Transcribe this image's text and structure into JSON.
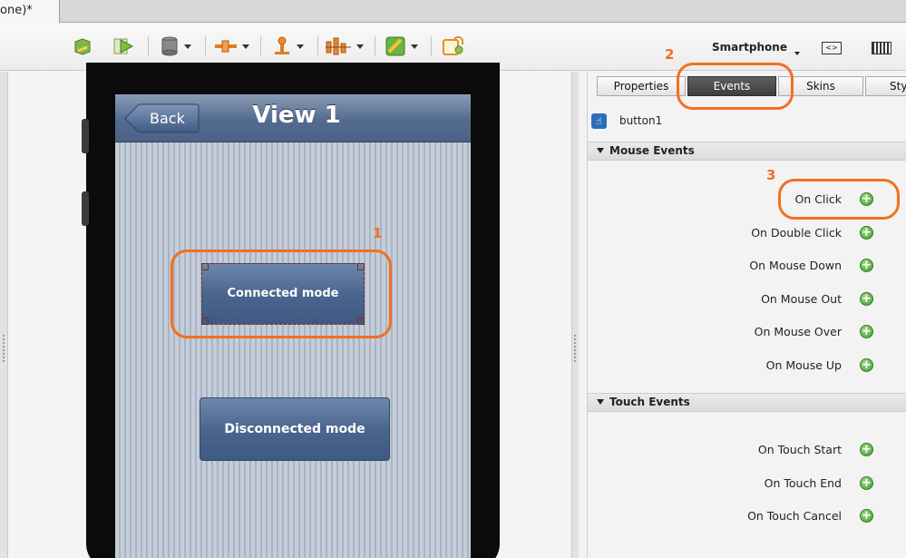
{
  "document_tab": {
    "label": "one)*"
  },
  "toolbar": {
    "device_label": "Smartphone",
    "orientation_icon_text": "<>",
    "icons": [
      "save-icon",
      "run-icon",
      "database-icon",
      "connector-icon",
      "component-icon",
      "chart-icon",
      "theme-icon",
      "lock-icon"
    ]
  },
  "preview": {
    "nav_back_label": "Back",
    "nav_title": "View 1",
    "button_connected": "Connected mode",
    "button_disconnected": "Disconnected mode"
  },
  "panel": {
    "tabs": [
      {
        "label": "Properties",
        "active": false
      },
      {
        "label": "Events",
        "active": true
      },
      {
        "label": "Skins",
        "active": false
      },
      {
        "label": "Sty",
        "active": false
      }
    ],
    "component_name": "button1",
    "mouse_section": "Mouse Events",
    "mouse_events": [
      "On Click",
      "On Double Click",
      "On Mouse Down",
      "On Mouse Out",
      "On Mouse Over",
      "On Mouse Up"
    ],
    "touch_section": "Touch Events",
    "touch_events": [
      "On Touch Start",
      "On Touch End",
      "On Touch Cancel"
    ]
  },
  "annotations": {
    "n1": "1",
    "n2": "2",
    "n3": "3"
  },
  "colors": {
    "annotation": "#f26f1f",
    "ios_button": "#4b668e",
    "active_tab": "#3e3e3e",
    "add_icon": "#3c9a2c"
  }
}
